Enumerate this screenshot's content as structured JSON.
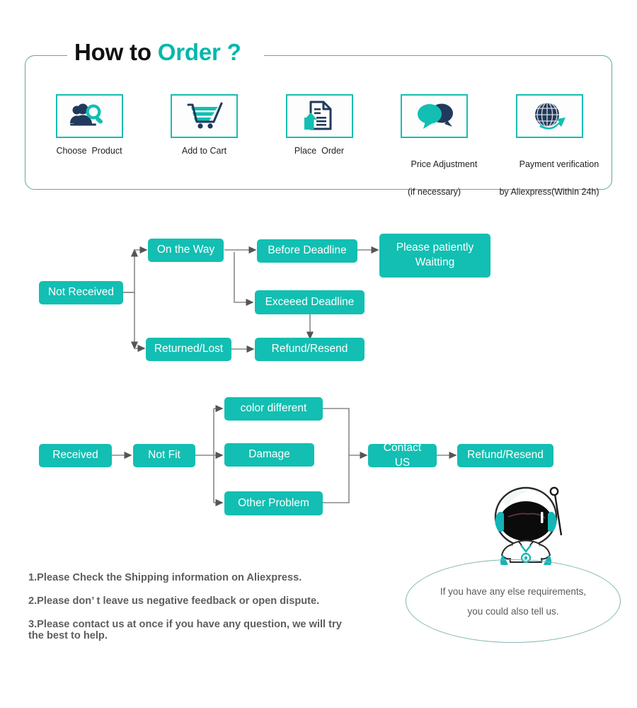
{
  "header": {
    "title_black": "How to ",
    "title_teal": "Order ?",
    "accent_color": "#12bfb2",
    "frame_color": "#5da8a3",
    "dark_color": "#21395c"
  },
  "steps": [
    {
      "icon": "person-search-icon",
      "label": "Choose  Product",
      "sublabel": ""
    },
    {
      "icon": "shopping-cart-icon",
      "label": "Add to Cart",
      "sublabel": ""
    },
    {
      "icon": "document-upload-icon",
      "label": "Place  Order",
      "sublabel": ""
    },
    {
      "icon": "speech-bubbles-icon",
      "label": "Price Adjustment",
      "sublabel": "(if necessary)"
    },
    {
      "icon": "globe-arrow-icon",
      "label": "Payment verification",
      "sublabel": "by Aliexpress(Within 24h)"
    }
  ],
  "flow_not_received": {
    "nodes": {
      "not_received": "Not Received",
      "on_the_way": "On the Way",
      "before_deadline": "Before Deadline",
      "please_waiting": "Please patiently\nWaitting",
      "exceed_deadline": "Exceeed Deadline",
      "returned_lost": "Returned/Lost",
      "refund_resend": "Refund/Resend"
    }
  },
  "flow_received": {
    "nodes": {
      "received": "Received",
      "not_fit": "Not Fit",
      "color_different": "color different",
      "damage": "Damage",
      "other_problem": "Other Problem",
      "contact_us": "Contact US",
      "refund_resend": "Refund/Resend"
    }
  },
  "notes": [
    "1.Please Check the Shipping information on Aliexpress.",
    "2.Please don’ t leave us negative feedback or open dispute.",
    "3.Please contact us at once if you have any question, we will try",
    " the best to help."
  ],
  "bubble": {
    "line1": "If you have any else requirements,",
    "line2": "you could also tell us."
  }
}
